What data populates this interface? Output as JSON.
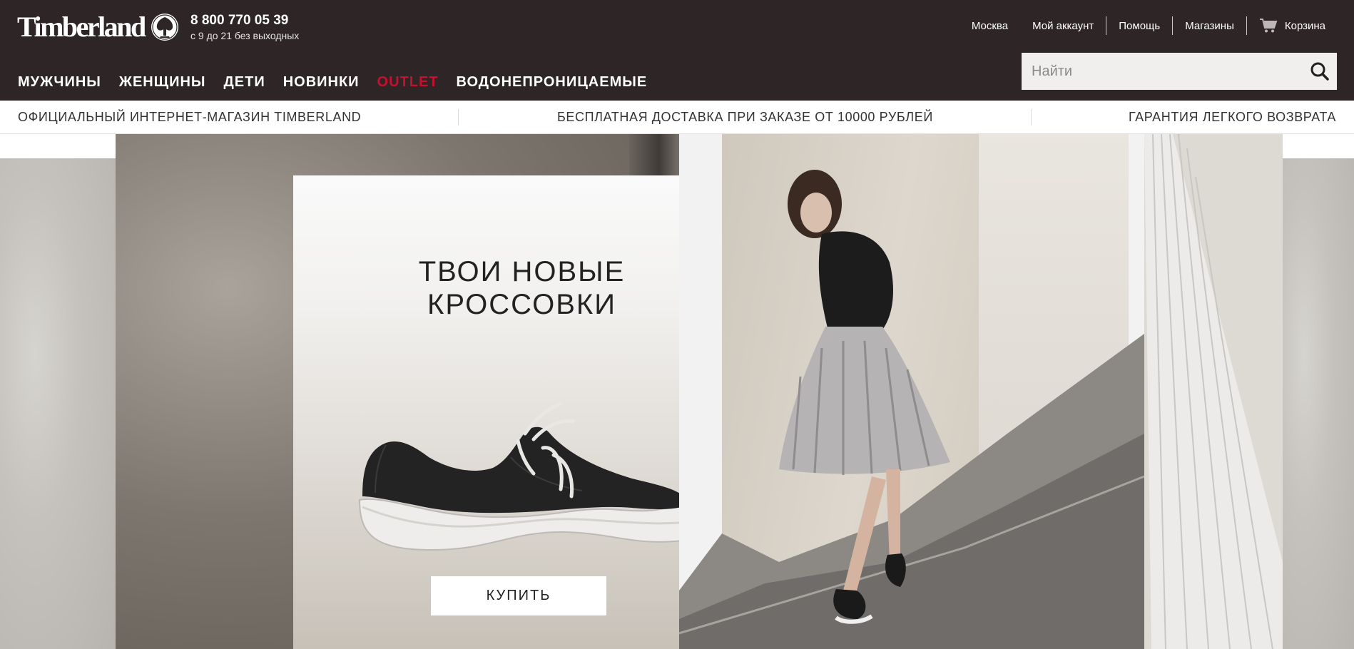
{
  "brand": {
    "logo_text": "Timberland",
    "logo_icon": "tree-icon"
  },
  "contact": {
    "phone": "8 800 770 05 39",
    "hours": "с 9 до 21 без выходных"
  },
  "utility_links": [
    "Москва",
    "Мой аккаунт",
    "Помощь",
    "Магазины",
    "Корзина"
  ],
  "cart_icon": "cart-icon",
  "nav": {
    "items": [
      "МУЖЧИНЫ",
      "ЖЕНЩИНЫ",
      "ДЕТИ",
      "НОВИНКИ",
      "OUTLET",
      "ВОДОНЕПРОНИЦАЕМЫЕ"
    ],
    "highlight_color": "#c8102e"
  },
  "search": {
    "placeholder": "Найти",
    "value": "",
    "icon": "search-icon"
  },
  "infobar": [
    "ОФИЦИАЛЬНЫЙ ИНТЕРНЕТ-МАГАЗИН TIMBERLAND",
    "БЕСПЛАТНАЯ ДОСТАВКА ПРИ ЗАКАЗЕ ОТ 10000 РУБЛЕЙ",
    "ГАРАНТИЯ ЛЕГКОГО ВОЗВРАТА"
  ],
  "promo": {
    "title_line1": "ТВОИ НОВЫЕ",
    "title_line2": "КРОССОВКИ",
    "button_label": "КУПИТЬ"
  },
  "colors": {
    "header_bg": "#2d2526",
    "text_light": "#ffffff",
    "search_bg": "#f1efee"
  }
}
